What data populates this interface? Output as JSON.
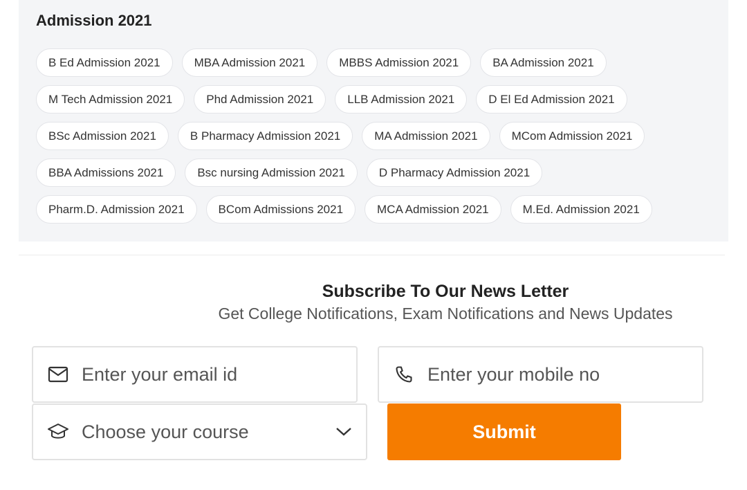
{
  "admission": {
    "title": "Admission 2021",
    "rows": [
      [
        "B Ed Admission 2021",
        "MBA Admission 2021",
        "MBBS Admission 2021",
        "BA Admission 2021"
      ],
      [
        "M Tech Admission 2021",
        "Phd Admission 2021",
        "LLB Admission 2021",
        "D El Ed Admission 2021"
      ],
      [
        "BSc Admission 2021",
        "B Pharmacy Admission 2021",
        "MA Admission 2021",
        "MCom Admission 2021"
      ],
      [
        "BBA Admissions 2021",
        "Bsc nursing Admission 2021",
        "D Pharmacy Admission 2021"
      ],
      [
        "Pharm.D. Admission 2021",
        "BCom Admissions 2021",
        "MCA Admission 2021",
        "M.Ed. Admission 2021"
      ]
    ]
  },
  "newsletter": {
    "title": "Subscribe To Our News Letter",
    "subtitle": "Get College Notifications, Exam Notifications and News Updates",
    "email_placeholder": "Enter your email id",
    "mobile_placeholder": "Enter your mobile no",
    "course_selected": "Choose your course",
    "submit_label": "Submit"
  },
  "icons": {
    "email": "envelope-icon",
    "mobile": "phone-icon",
    "course": "graduation-cap-icon",
    "dropdown": "chevron-down-icon"
  },
  "colors": {
    "accent": "#f57c00",
    "panel_bg": "#f4f5f7"
  }
}
